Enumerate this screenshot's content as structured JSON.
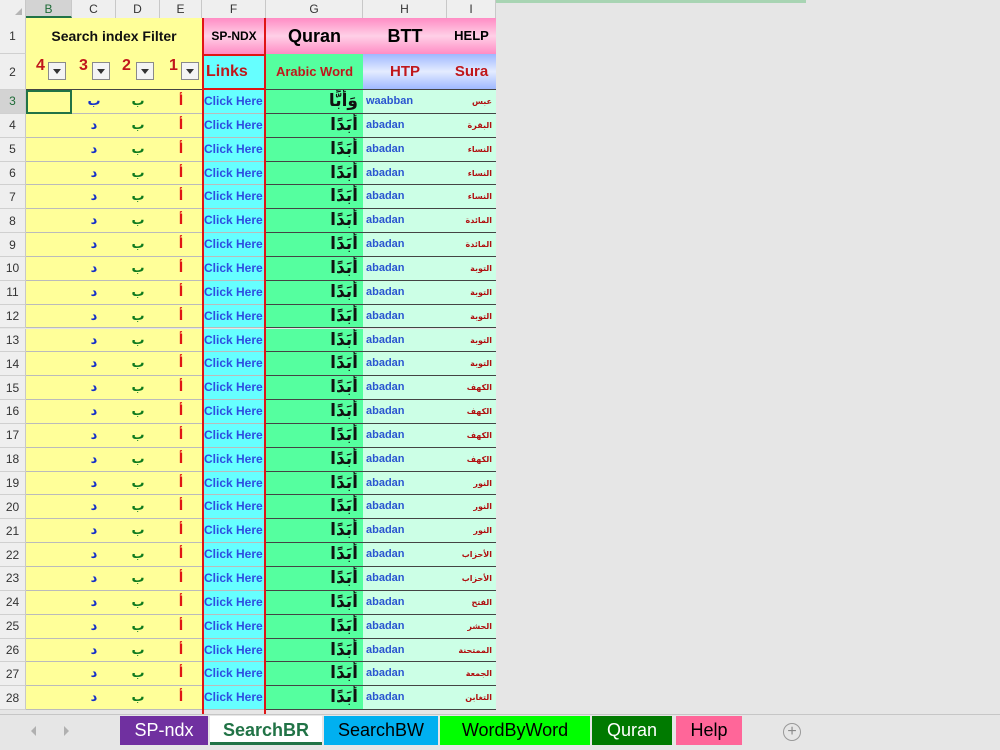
{
  "columns": [
    "B",
    "C",
    "D",
    "E",
    "F",
    "G",
    "H",
    "I"
  ],
  "row_numbers": [
    1,
    2,
    3,
    4,
    5,
    6,
    7,
    8,
    9,
    10,
    11,
    12,
    13,
    14,
    15,
    16,
    17,
    18,
    19,
    20,
    21,
    22,
    23,
    24,
    25,
    26,
    27,
    28
  ],
  "header_row1": {
    "search_filter": "Search index Filter",
    "sp_ndx": "SP-NDX",
    "quran": "Quran",
    "btt": "BTT",
    "help": "HELP"
  },
  "header_row2": {
    "filters": [
      "4",
      "3",
      "2",
      "1"
    ],
    "links": "Links",
    "arabic_word": "Arabic Word",
    "htp": "HTP",
    "sura": "Sura"
  },
  "rows": [
    {
      "c": "ب",
      "d": "ب",
      "e": "أ",
      "link": "Click Here",
      "arabic": "وَأَبًّا",
      "htp": "waabban",
      "sura": "عبس"
    },
    {
      "c": "د",
      "d": "ب",
      "e": "أ",
      "link": "Click Here",
      "arabic": "أَبَدًا",
      "htp": "abadan",
      "sura": "البقرة"
    },
    {
      "c": "د",
      "d": "ب",
      "e": "أ",
      "link": "Click Here",
      "arabic": "أَبَدًا",
      "htp": "abadan",
      "sura": "النساء"
    },
    {
      "c": "د",
      "d": "ب",
      "e": "أ",
      "link": "Click Here",
      "arabic": "أَبَدًا",
      "htp": "abadan",
      "sura": "النساء"
    },
    {
      "c": "د",
      "d": "ب",
      "e": "أ",
      "link": "Click Here",
      "arabic": "أَبَدًا",
      "htp": "abadan",
      "sura": "النساء"
    },
    {
      "c": "د",
      "d": "ب",
      "e": "أ",
      "link": "Click Here",
      "arabic": "أَبَدًا",
      "htp": "abadan",
      "sura": "المائدة"
    },
    {
      "c": "د",
      "d": "ب",
      "e": "أ",
      "link": "Click Here",
      "arabic": "أَبَدًا",
      "htp": "abadan",
      "sura": "المائدة"
    },
    {
      "c": "د",
      "d": "ب",
      "e": "أ",
      "link": "Click Here",
      "arabic": "أَبَدًا",
      "htp": "abadan",
      "sura": "التوبة"
    },
    {
      "c": "د",
      "d": "ب",
      "e": "أ",
      "link": "Click Here",
      "arabic": "أَبَدًا",
      "htp": "abadan",
      "sura": "التوبة"
    },
    {
      "c": "د",
      "d": "ب",
      "e": "أ",
      "link": "Click Here",
      "arabic": "أَبَدًا",
      "htp": "abadan",
      "sura": "التوبة"
    },
    {
      "c": "د",
      "d": "ب",
      "e": "أ",
      "link": "Click Here",
      "arabic": "أَبَدًا",
      "htp": "abadan",
      "sura": "التوبة"
    },
    {
      "c": "د",
      "d": "ب",
      "e": "أ",
      "link": "Click Here",
      "arabic": "أَبَدًا",
      "htp": "abadan",
      "sura": "التوبة"
    },
    {
      "c": "د",
      "d": "ب",
      "e": "أ",
      "link": "Click Here",
      "arabic": "أَبَدًا",
      "htp": "abadan",
      "sura": "الكهف"
    },
    {
      "c": "د",
      "d": "ب",
      "e": "أ",
      "link": "Click Here",
      "arabic": "أَبَدًا",
      "htp": "abadan",
      "sura": "الكهف"
    },
    {
      "c": "د",
      "d": "ب",
      "e": "أ",
      "link": "Click Here",
      "arabic": "أَبَدًا",
      "htp": "abadan",
      "sura": "الكهف"
    },
    {
      "c": "د",
      "d": "ب",
      "e": "أ",
      "link": "Click Here",
      "arabic": "أَبَدًا",
      "htp": "abadan",
      "sura": "الكهف"
    },
    {
      "c": "د",
      "d": "ب",
      "e": "أ",
      "link": "Click Here",
      "arabic": "أَبَدًا",
      "htp": "abadan",
      "sura": "النور"
    },
    {
      "c": "د",
      "d": "ب",
      "e": "أ",
      "link": "Click Here",
      "arabic": "أَبَدًا",
      "htp": "abadan",
      "sura": "النور"
    },
    {
      "c": "د",
      "d": "ب",
      "e": "أ",
      "link": "Click Here",
      "arabic": "أَبَدًا",
      "htp": "abadan",
      "sura": "النور"
    },
    {
      "c": "د",
      "d": "ب",
      "e": "أ",
      "link": "Click Here",
      "arabic": "أَبَدًا",
      "htp": "abadan",
      "sura": "الأحزاب"
    },
    {
      "c": "د",
      "d": "ب",
      "e": "أ",
      "link": "Click Here",
      "arabic": "أَبَدًا",
      "htp": "abadan",
      "sura": "الأحزاب"
    },
    {
      "c": "د",
      "d": "ب",
      "e": "أ",
      "link": "Click Here",
      "arabic": "أَبَدًا",
      "htp": "abadan",
      "sura": "الفتح"
    },
    {
      "c": "د",
      "d": "ب",
      "e": "أ",
      "link": "Click Here",
      "arabic": "أَبَدًا",
      "htp": "abadan",
      "sura": "الحشر"
    },
    {
      "c": "د",
      "d": "ب",
      "e": "أ",
      "link": "Click Here",
      "arabic": "أَبَدًا",
      "htp": "abadan",
      "sura": "الممتحنة"
    },
    {
      "c": "د",
      "d": "ب",
      "e": "أ",
      "link": "Click Here",
      "arabic": "أَبَدًا",
      "htp": "abadan",
      "sura": "الجمعة"
    },
    {
      "c": "د",
      "d": "ب",
      "e": "أ",
      "link": "Click Here",
      "arabic": "أَبَدًا",
      "htp": "abadan",
      "sura": "التغابن"
    }
  ],
  "sheet_tabs": [
    {
      "label": "SP-ndx",
      "bg": "#7030a0",
      "fg": "#ffffff"
    },
    {
      "label": "SearchBR",
      "bg": "#ffffff",
      "fg": "#217346",
      "active": true
    },
    {
      "label": "SearchBW",
      "bg": "#00b0f0",
      "fg": "#000000"
    },
    {
      "label": "WordByWord",
      "bg": "#00ff00",
      "fg": "#000000"
    },
    {
      "label": "Quran",
      "bg": "#007a00",
      "fg": "#ffffff"
    },
    {
      "label": "Help",
      "bg": "#ff6699",
      "fg": "#000000"
    }
  ],
  "icons": {
    "new_sheet": "plus-circle-icon",
    "prev": "chevron-left-icon",
    "next": "chevron-right-icon"
  }
}
